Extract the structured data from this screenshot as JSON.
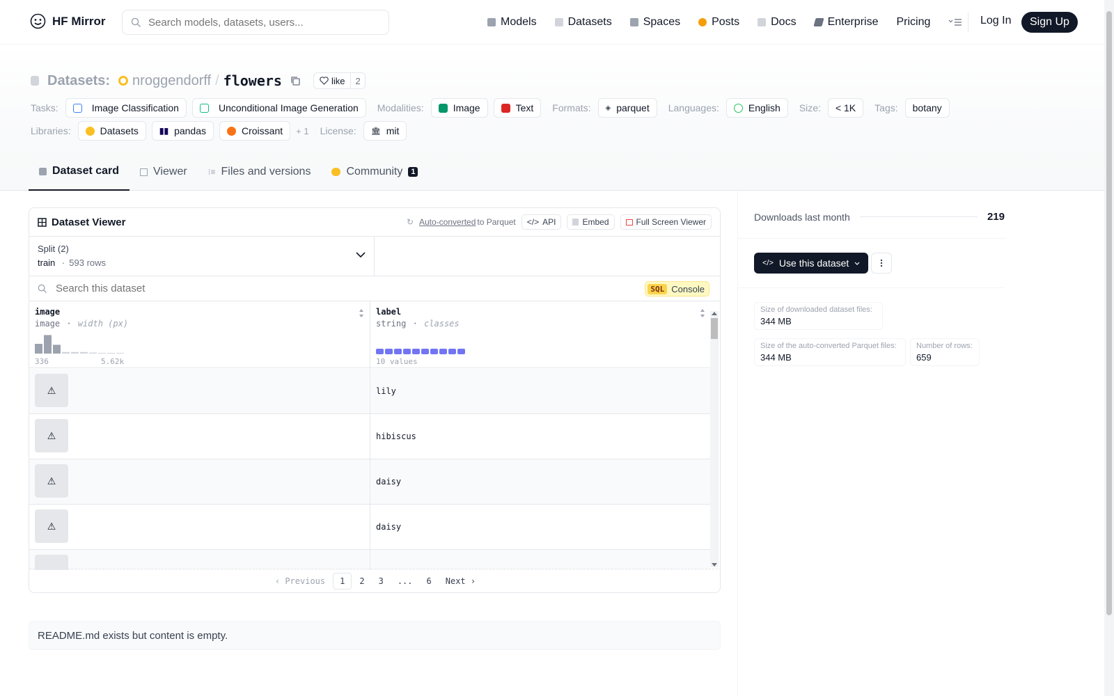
{
  "nav": {
    "brand": "HF Mirror",
    "search_placeholder": "Search models, datasets, users...",
    "links": [
      {
        "label": "Models",
        "icon": "models-icon",
        "color": "#9ca3af"
      },
      {
        "label": "Datasets",
        "icon": "datasets-icon",
        "color": "#d1d5db"
      },
      {
        "label": "Spaces",
        "icon": "spaces-icon",
        "color": "#9ca3af"
      },
      {
        "label": "Posts",
        "icon": "posts-icon",
        "color": "#f59e0b"
      },
      {
        "label": "Docs",
        "icon": "docs-icon",
        "color": "#d1d5db"
      },
      {
        "label": "Enterprise",
        "icon": "enterprise-icon",
        "color": "#6b7280"
      },
      {
        "label": "Pricing",
        "icon": "",
        "color": ""
      }
    ],
    "login": "Log In",
    "signup": "Sign Up"
  },
  "header": {
    "prefix": "Datasets:",
    "owner": "nroggendorff",
    "slash": "/",
    "name": "flowers",
    "like_label": "like",
    "like_count": "2",
    "tasks_label": "Tasks:",
    "tasks": [
      "Image Classification",
      "Unconditional Image Generation"
    ],
    "modalities_label": "Modalities:",
    "modalities": [
      "Image",
      "Text"
    ],
    "formats_label": "Formats:",
    "formats": [
      "parquet"
    ],
    "languages_label": "Languages:",
    "languages": [
      "English"
    ],
    "size_label": "Size:",
    "size": "< 1K",
    "tags_label": "Tags:",
    "tags": [
      "botany"
    ],
    "libraries_label": "Libraries:",
    "libraries": [
      "Datasets",
      "pandas",
      "Croissant"
    ],
    "libraries_more": "+ 1",
    "license_label": "License:",
    "license": "mit"
  },
  "tabs": [
    {
      "label": "Dataset card",
      "active": true
    },
    {
      "label": "Viewer",
      "active": false
    },
    {
      "label": "Files and versions",
      "active": false
    },
    {
      "label": "Community",
      "active": false,
      "badge": "1"
    }
  ],
  "viewer": {
    "title": "Dataset Viewer",
    "auto_converted": "Auto-converted",
    "to_parquet": "to Parquet",
    "api_label": "API",
    "embed_label": "Embed",
    "fullscreen_label": "Full Screen Viewer",
    "split_label": "Split (2)",
    "split_value": "train",
    "split_sep": "·",
    "split_rows": "593 rows",
    "search_placeholder": "Search this dataset",
    "sql_badge": "SQL",
    "sql_label": "Console",
    "columns": [
      {
        "name": "image",
        "type": "image",
        "sep": "·",
        "stat": "width (px)",
        "min": "336",
        "max": "5.62k",
        "hist": [
          0.5,
          0.95,
          0.45,
          0.08,
          0.08,
          0.08,
          0.05,
          0,
          0.03,
          0.03
        ]
      },
      {
        "name": "label",
        "type": "string",
        "sep": "·",
        "stat": "classes",
        "footer": "10 values",
        "classes": 10
      }
    ],
    "rows": [
      {
        "label": "lily"
      },
      {
        "label": "hibiscus"
      },
      {
        "label": "daisy"
      },
      {
        "label": "daisy"
      },
      {
        "label": ""
      }
    ],
    "pager": {
      "prev": "Previous",
      "pages": [
        "1",
        "2",
        "3",
        "...",
        "6"
      ],
      "current": "1",
      "next": "Next"
    }
  },
  "readme_text": "README.md exists but content is empty.",
  "sidebar": {
    "downloads_label": "Downloads last month",
    "downloads_value": "219",
    "use_button": "Use this dataset",
    "stats": [
      {
        "label": "Size of downloaded dataset files:",
        "value": "344 MB"
      },
      {
        "label": "Size of the auto-converted Parquet files:",
        "value": "344 MB"
      },
      {
        "label": "Number of rows:",
        "value": "659"
      }
    ]
  }
}
